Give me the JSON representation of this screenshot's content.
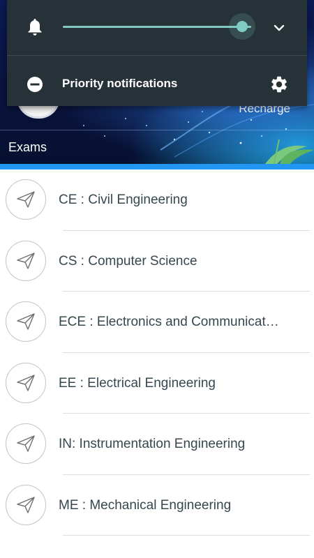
{
  "notification_shade": {
    "priority_label": "Priority notifications",
    "volume_level": 0.95
  },
  "header": {
    "recharge_label": "Recharge",
    "section_title": "Exams"
  },
  "exams": [
    {
      "label": "CE : Civil Engineering"
    },
    {
      "label": "CS : Computer Science"
    },
    {
      "label": "ECE : Electronics and Communicat…"
    },
    {
      "label": "EE : Electrical Engineering"
    },
    {
      "label": "IN: Instrumentation Engineering"
    },
    {
      "label": "ME : Mechanical Engineering"
    }
  ],
  "icons": {
    "volume": "bell-icon",
    "expand": "chevron-down-icon",
    "priority": "minus-circle-icon",
    "settings": "gear-icon",
    "list_item": "paper-plane-icon"
  },
  "colors": {
    "shade_background": "#263238",
    "slider_accent": "#80cbc4",
    "banner_accent": "#2196f3",
    "list_text": "#37474f"
  }
}
